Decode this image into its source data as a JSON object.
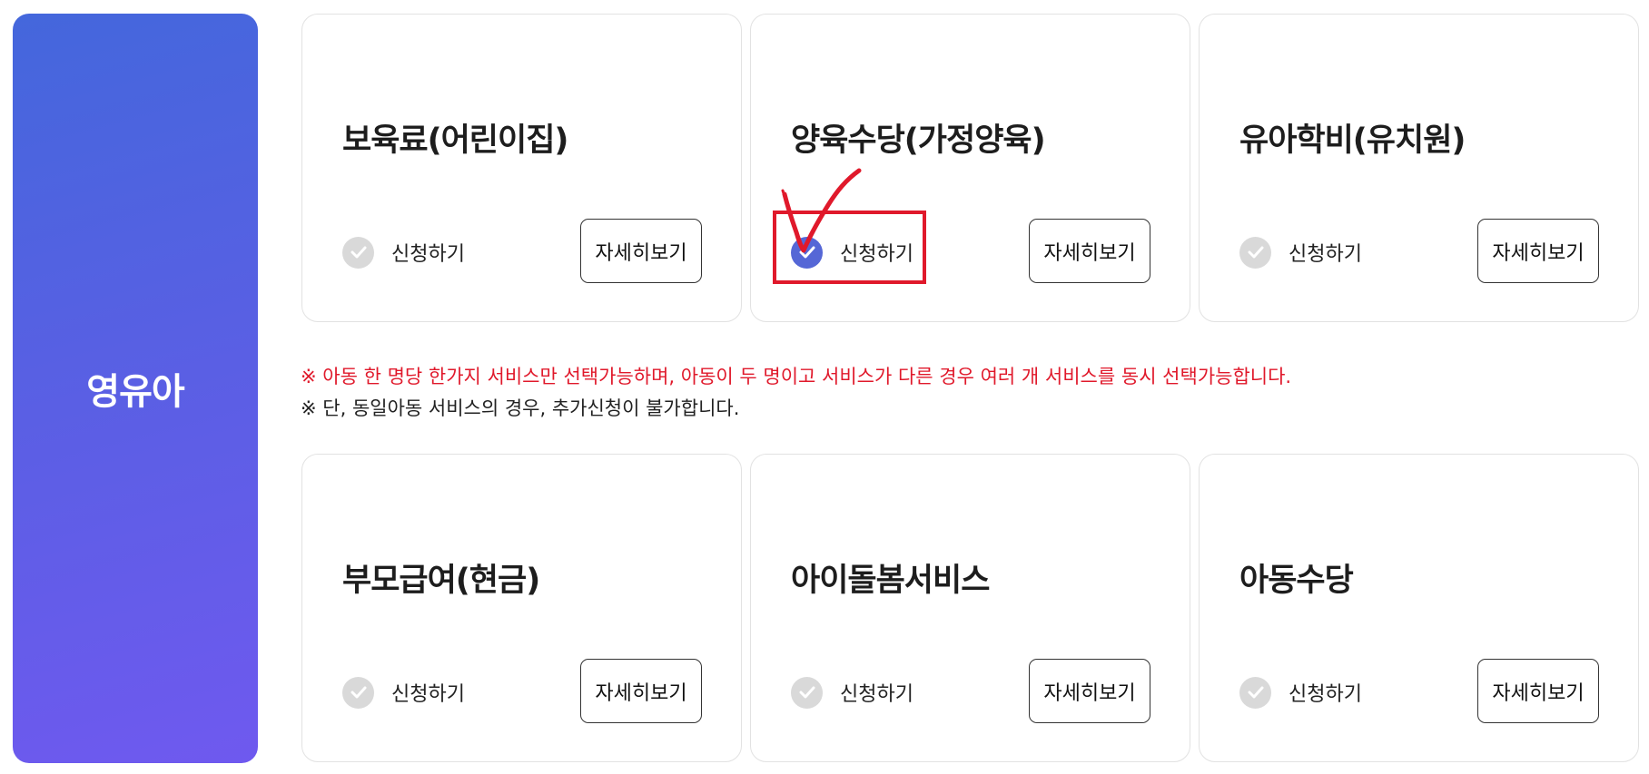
{
  "category": {
    "label": "영유아",
    "gradient_top": "#4467dc",
    "gradient_bottom": "#6f59ef"
  },
  "services": [
    {
      "title": "보육료(어린이집)",
      "apply_label": "신청하기",
      "apply_checked": false,
      "detail_label": "자세히보기"
    },
    {
      "title": "양육수당(가정양육)",
      "apply_label": "신청하기",
      "apply_checked": true,
      "detail_label": "자세히보기"
    },
    {
      "title": "유아학비(유치원)",
      "apply_label": "신청하기",
      "apply_checked": false,
      "detail_label": "자세히보기"
    },
    {
      "title": "부모급여(현금)",
      "apply_label": "신청하기",
      "apply_checked": false,
      "detail_label": "자세히보기"
    },
    {
      "title": "아이돌봄서비스",
      "apply_label": "신청하기",
      "apply_checked": false,
      "detail_label": "자세히보기"
    },
    {
      "title": "아동수당",
      "apply_label": "신청하기",
      "apply_checked": false,
      "detail_label": "자세히보기"
    }
  ],
  "notices": {
    "line1": "※ 아동 한 명당 한가지 서비스만 선택가능하며, 아동이 두 명이고 서비스가 다른 경우 여러 개 서비스를 동시 선택가능합니다.",
    "line2": "※ 단, 동일아동 서비스의 경우, 추가신청이 불가합니다."
  },
  "colors": {
    "check_on": "#5567d6",
    "check_off": "#d9d9d9",
    "annotation_red": "#e0192b"
  },
  "icons": {
    "check": "checkmark-icon",
    "annotation": "hand-drawn-checkmark"
  }
}
